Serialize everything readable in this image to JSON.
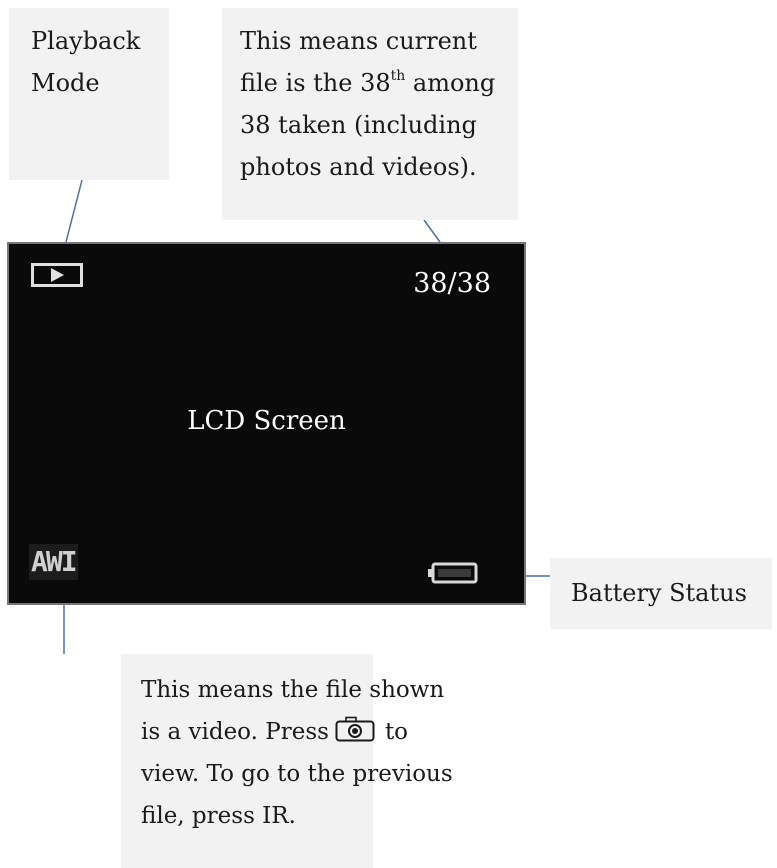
{
  "callouts": {
    "playback": {
      "line1": "Playback",
      "line2": "Mode"
    },
    "count": {
      "line1": "This means current",
      "line2_pre": "file is the 38",
      "line2_sup": "th",
      "line2_post": " among",
      "line3": "38 taken (including",
      "line4": "photos and videos)."
    },
    "battery": {
      "text": "Battery Status"
    },
    "video": {
      "line1": "This means the file shown",
      "line2_pre": "is a video. Press",
      "line2_post": "to",
      "line3": "view. To go to the previous",
      "line4": "file, press IR."
    }
  },
  "lcd": {
    "counter": "38/38",
    "title": "LCD Screen",
    "file_type": "AWI"
  },
  "icons": {
    "mode": "play-icon",
    "battery": "battery-icon",
    "shutter": "camera-icon"
  },
  "colors": {
    "callout_bg": "#f2f2f2",
    "connector": "#4a6fa5",
    "screen_bg": "#0a0a0a"
  }
}
